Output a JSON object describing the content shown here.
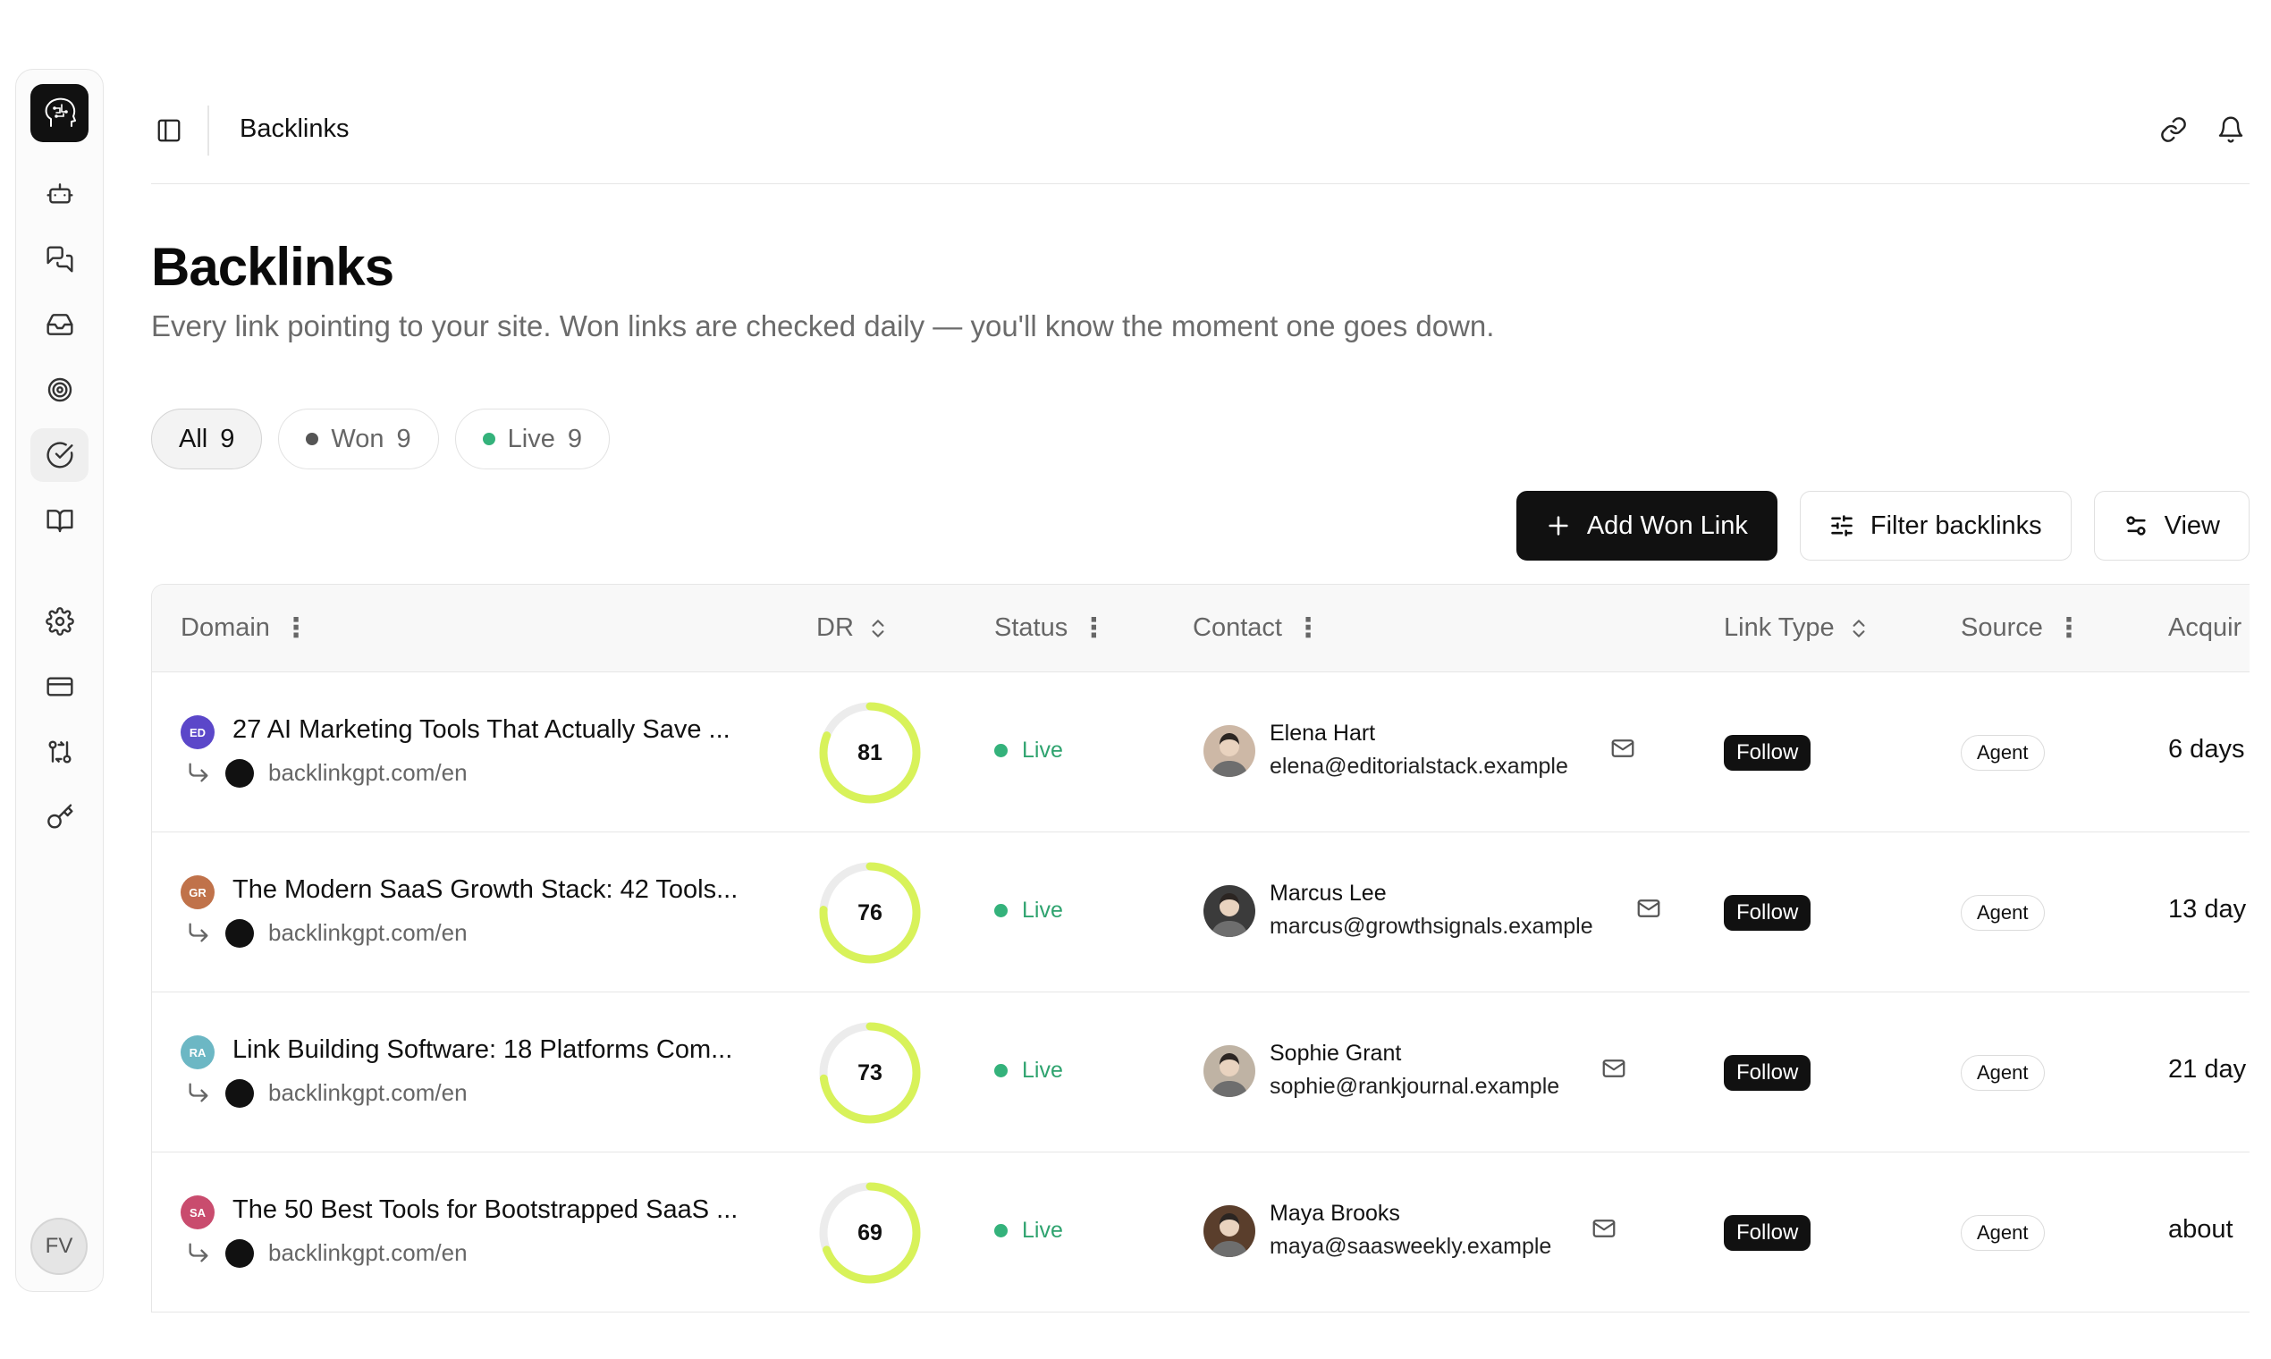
{
  "sidebar": {
    "items": [
      {
        "name": "bot-icon"
      },
      {
        "name": "messages-icon"
      },
      {
        "name": "inbox-icon"
      },
      {
        "name": "target-icon"
      },
      {
        "name": "check-circle-icon",
        "active": true
      },
      {
        "name": "book-open-icon"
      },
      {
        "name": "settings-icon"
      },
      {
        "name": "credit-card-icon"
      },
      {
        "name": "git-compare-icon"
      },
      {
        "name": "key-icon"
      }
    ],
    "user_initials": "FV"
  },
  "topbar": {
    "breadcrumb": "Backlinks",
    "icons": [
      "link-icon",
      "bell-icon"
    ]
  },
  "page": {
    "title": "Backlinks",
    "subtitle": "Every link pointing to your site. Won links are checked daily — you'll know the moment one goes down."
  },
  "filters": [
    {
      "label": "All",
      "count": "9",
      "active": true
    },
    {
      "label": "Won",
      "count": "9",
      "dot": "#555555"
    },
    {
      "label": "Live",
      "count": "9",
      "dot": "#34b27b"
    }
  ],
  "actions": {
    "add_label": "Add Won Link",
    "filter_label": "Filter backlinks",
    "view_label": "View"
  },
  "table": {
    "columns": [
      "Domain",
      "DR",
      "Status",
      "Contact",
      "Link Type",
      "Source",
      "Acquir"
    ],
    "rows": [
      {
        "initials": "ED",
        "badge_color": "#5b47c9",
        "title": "27 AI Marketing Tools That Actually Save ...",
        "url": "backlinkgpt.com/en",
        "dr": 81,
        "status": "Live",
        "contact_name": "Elena Hart",
        "contact_email": "elena@editorialstack.example",
        "link_type": "Follow",
        "source": "Agent",
        "acquired": "6 days"
      },
      {
        "initials": "GR",
        "badge_color": "#c0724a",
        "title": "The Modern SaaS Growth Stack: 42 Tools...",
        "url": "backlinkgpt.com/en",
        "dr": 76,
        "status": "Live",
        "contact_name": "Marcus Lee",
        "contact_email": "marcus@growthsignals.example",
        "link_type": "Follow",
        "source": "Agent",
        "acquired": "13 day"
      },
      {
        "initials": "RA",
        "badge_color": "#6cb7c4",
        "title": "Link Building Software: 18 Platforms Com...",
        "url": "backlinkgpt.com/en",
        "dr": 73,
        "status": "Live",
        "contact_name": "Sophie Grant",
        "contact_email": "sophie@rankjournal.example",
        "link_type": "Follow",
        "source": "Agent",
        "acquired": "21 day"
      },
      {
        "initials": "SA",
        "badge_color": "#c94c6e",
        "title": "The 50 Best Tools for Bootstrapped SaaS ...",
        "url": "backlinkgpt.com/en",
        "dr": 69,
        "status": "Live",
        "contact_name": "Maya Brooks",
        "contact_email": "maya@saasweekly.example",
        "link_type": "Follow",
        "source": "Agent",
        "acquired": "about"
      }
    ]
  },
  "colors": {
    "accent": "#111111",
    "live_green": "#34b27b",
    "dr_ring": "#d8f25a",
    "dr_track": "#ececec"
  }
}
